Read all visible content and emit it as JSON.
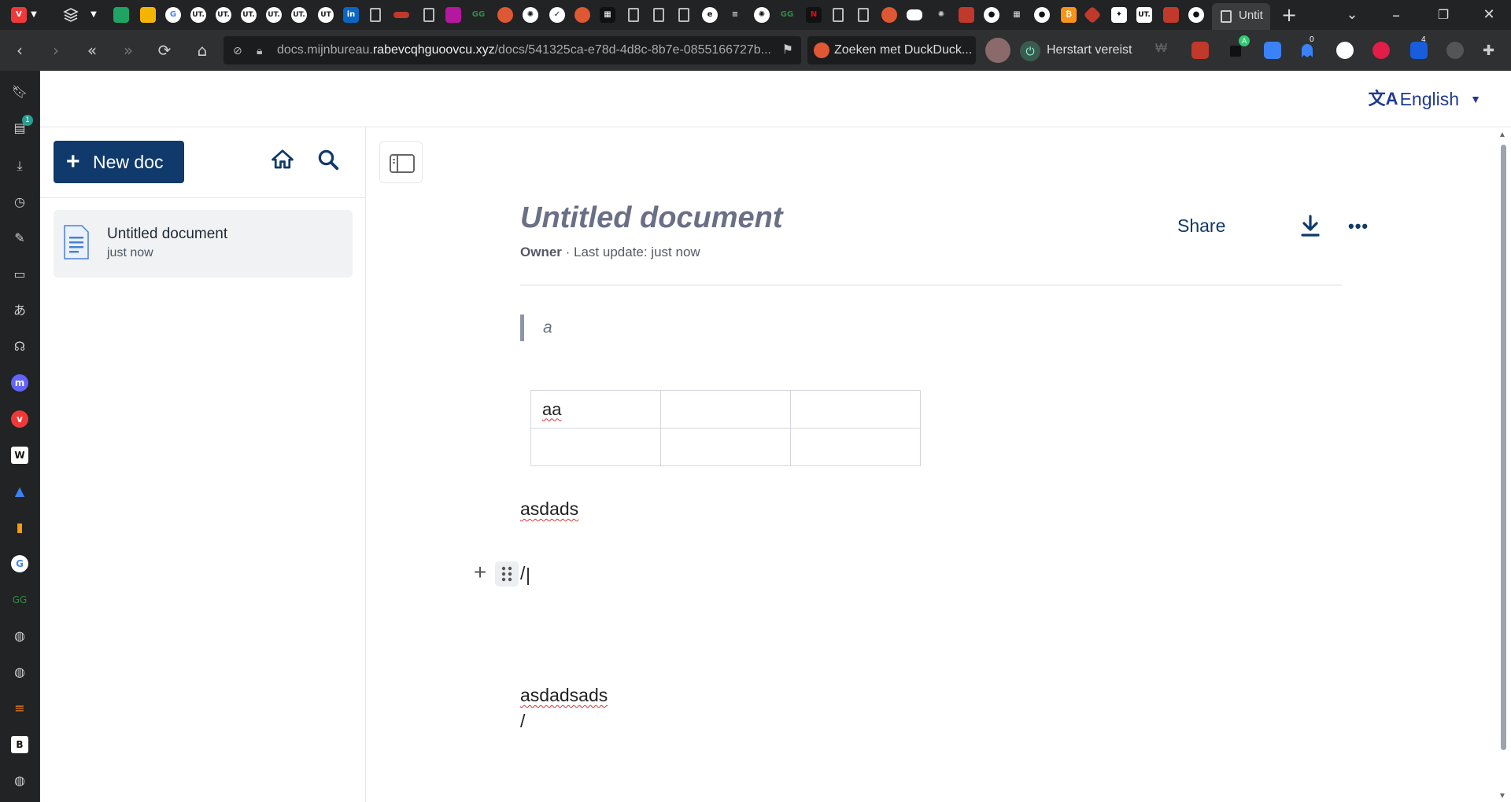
{
  "browser": {
    "active_tab_label": "Untit",
    "new_tab_glyph": "+",
    "window_minimize": "–",
    "window_restore": "❐",
    "window_close": "✕",
    "url_prefix": "docs.mijnbureau.",
    "url_host": "rabevcqhguoovcu.xyz",
    "url_path": "/docs/541325ca-e78d-4d8c-8b7e-0855166727b...",
    "search_engine_label": "Zoeken met DuckDuck...",
    "restart_label": "Herstart vereist",
    "panel_badge": "1",
    "ext_badge_a": "A",
    "ext_badge_zero": "0",
    "ext_badge_four": "4",
    "tab_icons": [
      {
        "label": "UT.",
        "color": "#2b2b2b"
      },
      {
        "label": "UT.",
        "color": "#2b2b2b"
      },
      {
        "label": "UT.",
        "color": "#2b2b2b"
      },
      {
        "label": "UT.",
        "color": "#2b2b2b"
      },
      {
        "label": "UT.",
        "color": "#2b2b2b"
      },
      {
        "label": "UT",
        "color": "#2b2b2b"
      },
      {
        "label": "in",
        "color": "#0a66c2"
      }
    ]
  },
  "app": {
    "language": "English",
    "new_doc_label": "New doc",
    "sidebar_doc": {
      "title": "Untitled document",
      "subtitle": "just now"
    }
  },
  "document": {
    "title": "Untitled document",
    "owner_label": "Owner",
    "meta": " · Last update: just now",
    "share_label": "Share",
    "more_label": "•••",
    "quote": "a",
    "table": [
      [
        "aa",
        "",
        ""
      ],
      [
        "",
        "",
        ""
      ]
    ],
    "paragraph_1": "asdads",
    "slash_1": "/",
    "paragraph_2": "asdadsads",
    "slash_2": "/"
  },
  "colors": {
    "primary": "#0f3a6b",
    "title_gray": "#6b6f86"
  }
}
